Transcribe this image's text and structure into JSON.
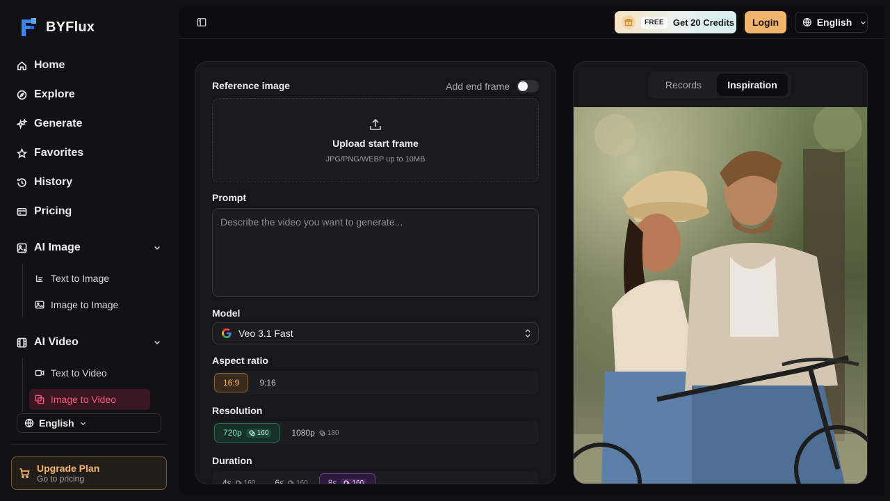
{
  "brand": {
    "name": "BYFlux"
  },
  "nav": {
    "home": "Home",
    "explore": "Explore",
    "generate": "Generate",
    "favorites": "Favorites",
    "history": "History",
    "pricing": "Pricing"
  },
  "ai_image": {
    "label": "AI Image",
    "items": [
      "Text to Image",
      "Image to Image"
    ]
  },
  "ai_video": {
    "label": "AI Video",
    "items": [
      "Text to Video",
      "Image to Video"
    ],
    "active_item": "Image to Video"
  },
  "sidebar_language": "English",
  "upgrade": {
    "title": "Upgrade Plan",
    "subtitle": "Go to pricing"
  },
  "topbar": {
    "free_tag": "FREE",
    "credits_label": "Get 20 Credits",
    "login_label": "Login",
    "language": "English"
  },
  "form": {
    "reference_label": "Reference image",
    "end_frame_label": "Add end frame",
    "end_frame_enabled": false,
    "upload_title": "Upload start frame",
    "upload_hint": "JPG/PNG/WEBP up to 10MB",
    "prompt_label": "Prompt",
    "prompt_placeholder": "Describe the video you want to generate...",
    "model_label": "Model",
    "model_value": "Veo 3.1 Fast",
    "aspect_label": "Aspect ratio",
    "aspect_options": [
      "16:9",
      "9:16"
    ],
    "aspect_selected": "16:9",
    "resolution_label": "Resolution",
    "resolution_options": [
      {
        "label": "720p",
        "cost": "160"
      },
      {
        "label": "1080p",
        "cost": "180"
      }
    ],
    "resolution_selected": "720p",
    "duration_label": "Duration",
    "duration_options": [
      {
        "label": "4s",
        "cost": "160"
      },
      {
        "label": "6s",
        "cost": "160"
      },
      {
        "label": "8s",
        "cost": "160"
      }
    ],
    "duration_selected": "8s"
  },
  "preview": {
    "tabs": [
      "Records",
      "Inspiration"
    ],
    "active_tab": "Inspiration"
  },
  "colors": {
    "accent_orange": "#f2b46a",
    "active_pink": "#f2577d",
    "selected_green": "#7fe3bd",
    "selected_purple": "#d8a9ff"
  }
}
